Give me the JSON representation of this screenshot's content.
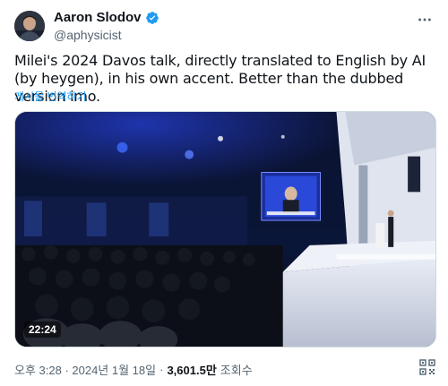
{
  "author": {
    "display_name": "Aaron Slodov",
    "handle": "@aphysicist",
    "verified_color": "#1d9bf0",
    "avatar_icon": "avatar-photo"
  },
  "tweet": {
    "text": "Milei's 2024 Davos talk, directly translated to English by AI (by heygen), in his own accent. Better than the dubbed version imo.",
    "translate_label": "게시물 번역하기"
  },
  "media": {
    "type": "video",
    "duration": "22:24"
  },
  "meta": {
    "timestamp": "오후 3:28 · 2024년 1월 18일",
    "views_count": "3,601.5만",
    "views_label": "조회수"
  },
  "icons": {
    "more": "more-icon",
    "qr": "qr-code-icon",
    "verified": "verified-badge-icon"
  },
  "colors": {
    "accent": "#1d9bf0",
    "text": "#0f1419",
    "secondary": "#536471"
  }
}
